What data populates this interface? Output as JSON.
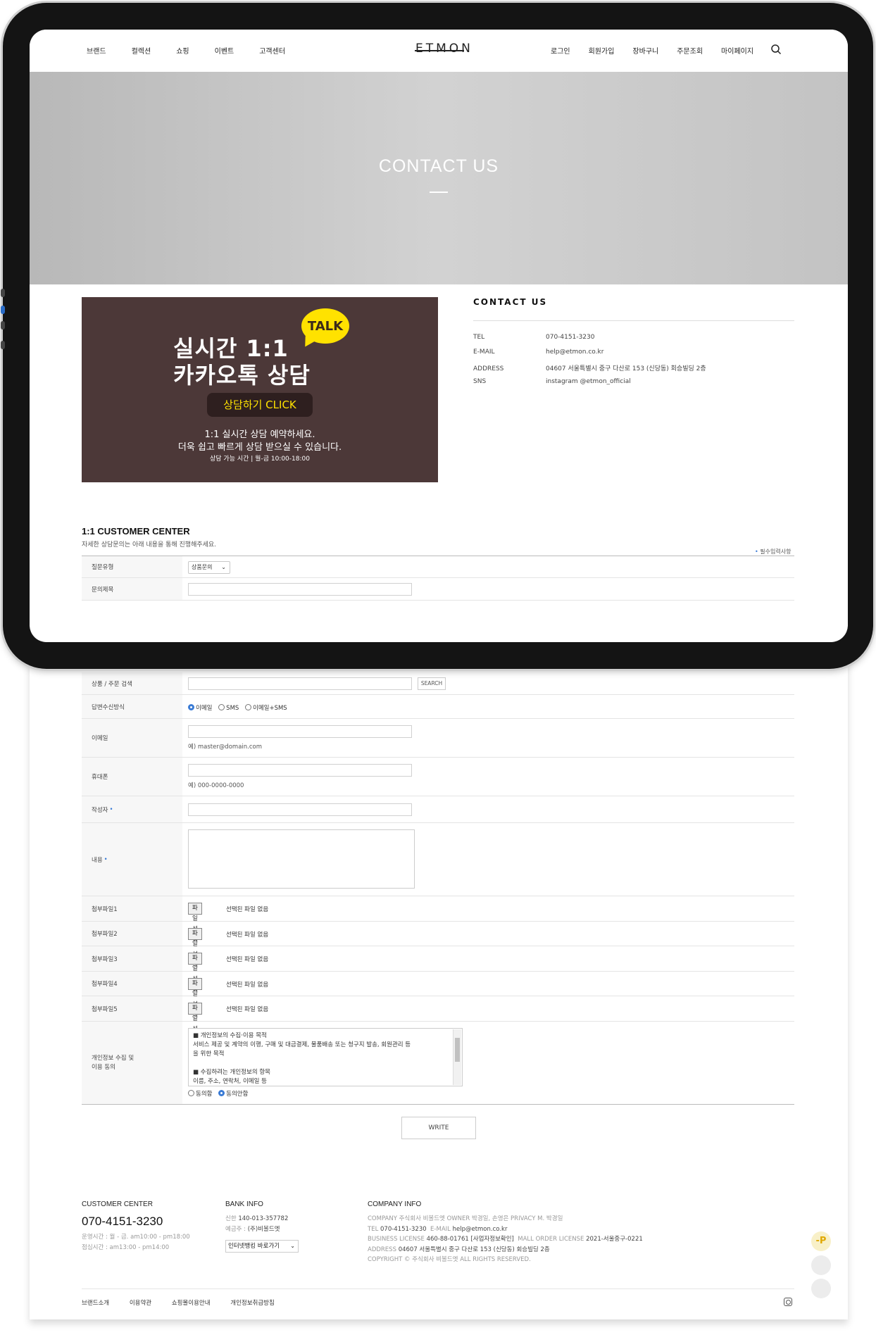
{
  "header": {
    "nav_left": [
      "브랜드",
      "컬렉션",
      "쇼핑",
      "이벤트",
      "고객센터"
    ],
    "logo": "ETMON",
    "nav_right": [
      "로그인",
      "회원가입",
      "장바구니",
      "주문조회",
      "마이페이지"
    ]
  },
  "hero": {
    "title": "CONTACT US"
  },
  "kakao": {
    "line1": "실시간 1:1",
    "line2": "카카오톡 상담",
    "talk": "TALK",
    "button": "상담하기 CLICK",
    "desc1": "1:1 실시간 상담 예약하세요.",
    "desc2": "더욱 쉽고 빠르게 상담 받으실 수 있습니다.",
    "hours": "상담 가능 시간 | 월-금 10:00-18:00"
  },
  "contact": {
    "title": "CONTACT US",
    "rows": [
      {
        "k": "TEL",
        "v": "070-4151-3230"
      },
      {
        "k": "E-MAIL",
        "v": "help@etmon.co.kr"
      },
      {
        "k": "ADDRESS",
        "v": "04607 서울특별시 중구 다산로 153 (신당동) 회승빌딩 2층"
      },
      {
        "k": "SNS",
        "v": "instagram @etmon_official"
      }
    ]
  },
  "cc": {
    "title": "1:1 CUSTOMER CENTER",
    "subtitle": "자세한 상담문의는 아래 내용을 통해 진행해주세요.",
    "required_note": "필수입력사항"
  },
  "form": {
    "type_label": "질문유형",
    "type_value": "상품문의",
    "subject_label": "문의제목",
    "product_label": "상품 / 주문 검색",
    "search_btn": "SEARCH",
    "reply_label": "답변수신방식",
    "reply_options": [
      "이메일",
      "SMS",
      "이메일+SMS"
    ],
    "email_label": "이메일",
    "email_hint": "예) master@domain.com",
    "phone_label": "휴대폰",
    "phone_hint": "예) 000-0000-0000",
    "writer_label": "작성자",
    "content_label": "내용",
    "file_labels": [
      "첨부파일1",
      "첨부파일2",
      "첨부파일3",
      "첨부파일4",
      "첨부파일5"
    ],
    "file_btn": "파일 선택",
    "file_none": "선택된 파일 없음",
    "privacy_label_1": "개인정보 수집 및",
    "privacy_label_2": "이용 동의",
    "privacy_text": [
      "■ 개인정보의 수집·이용 목적",
      "서비스 제공 및 계약의 이행, 구매 및 대금결제, 물품배송 또는 청구지 발송, 회원관리 등",
      "을 위한 목적",
      "",
      "■ 수집하려는 개인정보의 항목",
      "이름, 주소, 연락처, 이메일 등"
    ],
    "agree": "동의함",
    "disagree": "동의안함",
    "write_btn": "WRITE"
  },
  "footer": {
    "cc_title": "CUSTOMER CENTER",
    "phone": "070-4151-3230",
    "hours1": "운영시간 : 월 - 금. am10:00 - pm18:00",
    "hours2": "점심시간 : am13:00 - pm14:00",
    "bank_title": "BANK INFO",
    "bank_line1_k": "신한",
    "bank_line1_v": "140-013-357782",
    "bank_line2_k": "예금주 :",
    "bank_line2_v": "(주)비볼드엣",
    "bank_select": "인터넷뱅킹 바로가기",
    "company_title": "COMPANY INFO",
    "company_line1": "COMPANY 주식회사 비볼드엣   OWNER 박경일, 손영은   PRIVACY M. 박경일",
    "company_line2_k": "TEL",
    "company_line2_v": "070-4151-3230",
    "company_line2_k2": "E-MAIL",
    "company_line2_v2": "help@etmon.co.kr",
    "company_line3_k": "BUSINESS LICENSE",
    "company_line3_v": "460-88-01761 [사업자정보확인]",
    "company_line3_k2": "MALL ORDER LICENSE",
    "company_line3_v2": "2021-서울중구-0221",
    "company_line4_k": "ADDRESS",
    "company_line4_v": "04607 서울특별시 중구 다산로 153 (신당동) 회승빌딩 2층",
    "copyright": "COPYRIGHT © 주식회사 비볼드엣 ALL RIGHTS RESERVED.",
    "links": [
      "브랜드소개",
      "이용약관",
      "쇼핑몰이용안내",
      "개인정보취급방침"
    ],
    "p_badge": "-P"
  },
  "icons": [
    "search-icon",
    "instagram-icon",
    "scroll-top-icon",
    "scroll-bottom-icon"
  ]
}
